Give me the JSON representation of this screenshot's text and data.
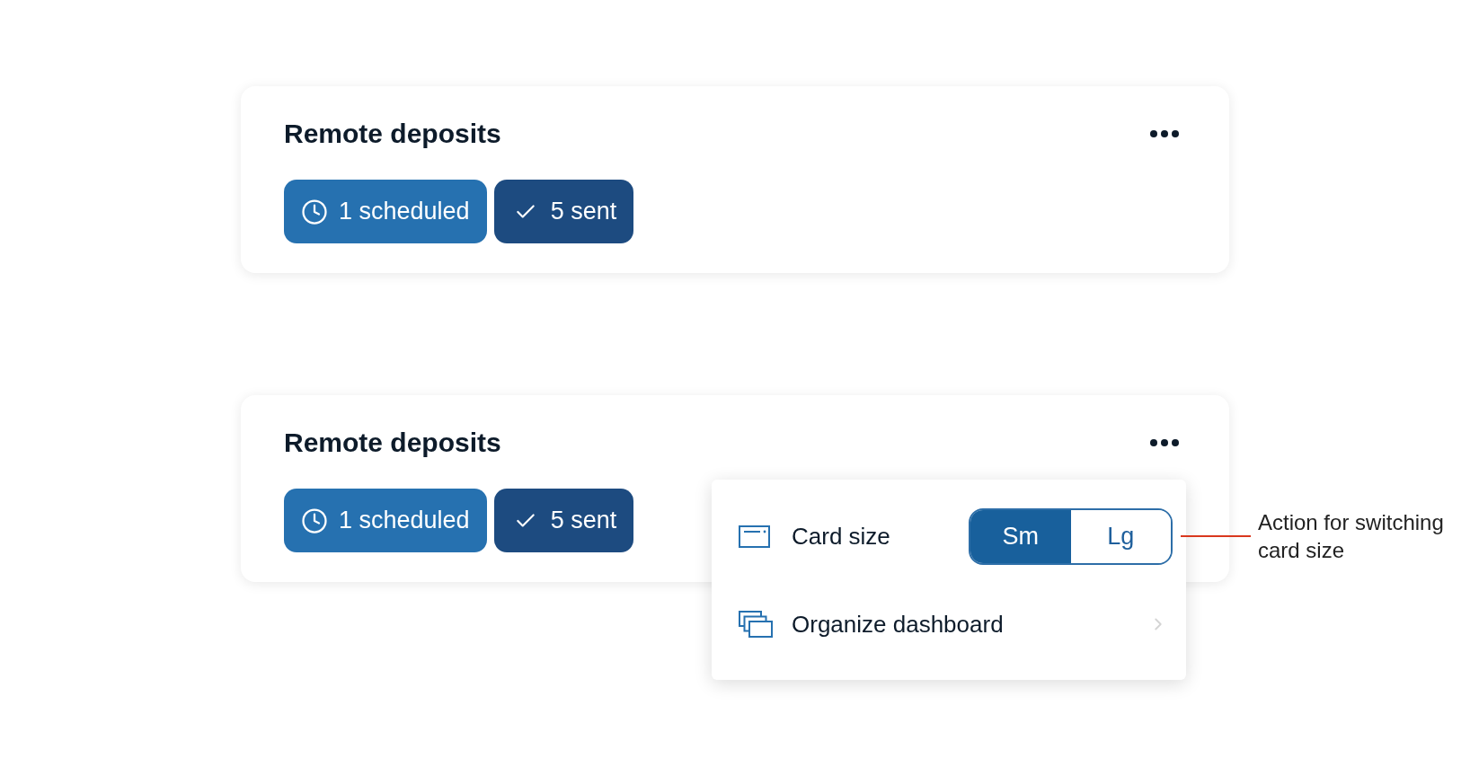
{
  "cards": [
    {
      "title": "Remote deposits",
      "chips": [
        {
          "kind": "scheduled",
          "label": "1 scheduled"
        },
        {
          "kind": "sent",
          "label": "5 sent"
        }
      ]
    },
    {
      "title": "Remote deposits",
      "chips": [
        {
          "kind": "scheduled",
          "label": "1 scheduled"
        },
        {
          "kind": "sent",
          "label": "5 sent"
        }
      ],
      "menu": {
        "items": [
          {
            "kind": "toggle",
            "label": "Card size",
            "options": [
              {
                "label": "Sm",
                "selected": true
              },
              {
                "label": "Lg",
                "selected": false
              }
            ]
          },
          {
            "kind": "submenu",
            "label": "Organize dashboard"
          }
        ]
      },
      "annotation": {
        "text": "Action for switching card size"
      }
    }
  ]
}
